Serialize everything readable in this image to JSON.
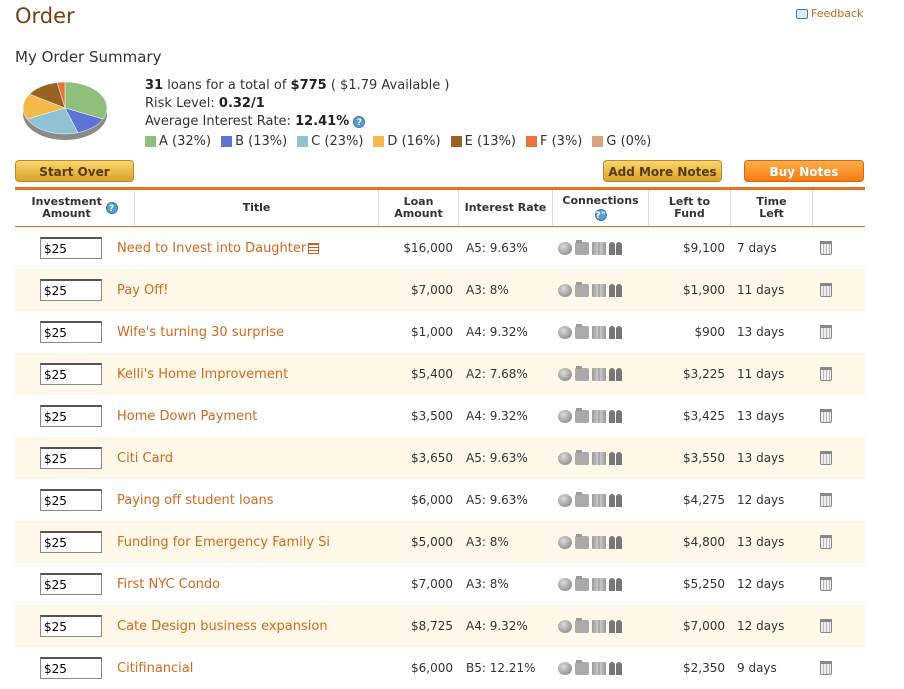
{
  "page": {
    "title": "Order",
    "feedback_label": "Feedback"
  },
  "summary": {
    "title": "My Order Summary",
    "loan_count": "31",
    "loans_text": " loans for a total of ",
    "total": "$775",
    "available": " ( $1.79 Available )",
    "risk_label": "Risk Level: ",
    "risk_value": "0.32/1",
    "rate_label": "Average Interest Rate: ",
    "rate_value": "12.41%",
    "legend": [
      {
        "label": "A (32%)",
        "color": "#8fbf7a",
        "pct": 32
      },
      {
        "label": "B (13%)",
        "color": "#5b74d6",
        "pct": 13
      },
      {
        "label": "C (23%)",
        "color": "#8fc3d4",
        "pct": 23
      },
      {
        "label": "D (16%)",
        "color": "#f5b84a",
        "pct": 16
      },
      {
        "label": "E (13%)",
        "color": "#9a6324",
        "pct": 13
      },
      {
        "label": "F (3%)",
        "color": "#e8743b",
        "pct": 3
      },
      {
        "label": "G (0%)",
        "color": "#d9a382",
        "pct": 0
      }
    ]
  },
  "buttons": {
    "start_over": "Start Over",
    "add_more": "Add More Notes",
    "buy": "Buy Notes"
  },
  "table": {
    "headers": {
      "investment": "Investment Amount",
      "title": "Title",
      "loan_amount": "Loan Amount",
      "interest_rate": "Interest Rate",
      "connections": "Connections",
      "left_to_fund": "Left to Fund",
      "time_left": "Time Left"
    },
    "rows": [
      {
        "amount": "$25",
        "title": "Need to Invest into Daughter",
        "loan": "$16,000",
        "rate": "A5: 9.63%",
        "left": "$9,100",
        "time": "7 days"
      },
      {
        "amount": "$25",
        "title": "Pay Off!",
        "loan": "$7,000",
        "rate": "A3: 8%",
        "left": "$1,900",
        "time": "11 days"
      },
      {
        "amount": "$25",
        "title": "Wife's turning 30 surprise",
        "loan": "$1,000",
        "rate": "A4: 9.32%",
        "left": "$900",
        "time": "13 days"
      },
      {
        "amount": "$25",
        "title": "Kelli's Home Improvement",
        "loan": "$5,400",
        "rate": "A2: 7.68%",
        "left": "$3,225",
        "time": "11 days"
      },
      {
        "amount": "$25",
        "title": "Home Down Payment",
        "loan": "$3,500",
        "rate": "A4: 9.32%",
        "left": "$3,425",
        "time": "13 days"
      },
      {
        "amount": "$25",
        "title": "Citi Card",
        "loan": "$3,650",
        "rate": "A5: 9.63%",
        "left": "$3,550",
        "time": "13 days"
      },
      {
        "amount": "$25",
        "title": "Paying off student loans",
        "loan": "$6,000",
        "rate": "A5: 9.63%",
        "left": "$4,275",
        "time": "12 days"
      },
      {
        "amount": "$25",
        "title": "Funding for Emergency Family Si",
        "loan": "$5,000",
        "rate": "A3: 8%",
        "left": "$4,800",
        "time": "13 days"
      },
      {
        "amount": "$25",
        "title": "First NYC Condo",
        "loan": "$7,000",
        "rate": "A3: 8%",
        "left": "$5,250",
        "time": "12 days"
      },
      {
        "amount": "$25",
        "title": "Cate Design business expansion",
        "loan": "$8,725",
        "rate": "A4: 9.32%",
        "left": "$7,000",
        "time": "12 days"
      },
      {
        "amount": "$25",
        "title": "Citifinancial",
        "loan": "$6,000",
        "rate": "B5: 12.21%",
        "left": "$2,350",
        "time": "9 days"
      }
    ]
  }
}
